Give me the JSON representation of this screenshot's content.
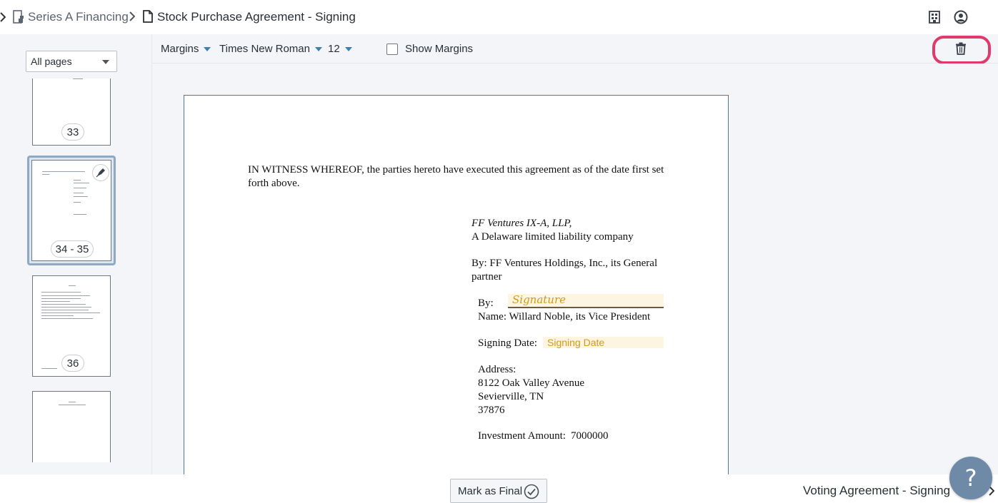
{
  "breadcrumb": {
    "series": "Series A Financing",
    "document": "Stock Purchase Agreement - Signing"
  },
  "sidebar": {
    "page_filter": "All pages",
    "thumbnails": [
      {
        "label": "33"
      },
      {
        "label": "34 - 35",
        "selected": true,
        "icon": "pen-nib-icon"
      },
      {
        "label": "36"
      },
      {
        "label": ""
      }
    ]
  },
  "toolbar": {
    "margins": "Margins",
    "font": "Times New Roman",
    "size": "12",
    "show_margins": "Show Margins",
    "show_margins_checked": false
  },
  "document": {
    "witness": "IN WITNESS WHEREOF, the parties hereto have executed this agreement as of the date first set",
    "witness_cont": "forth above.",
    "entity": "FF Ventures IX-A, LLP,",
    "entity_desc": "A Delaware limited liability company",
    "by_line": "By: FF Ventures Holdings, Inc., its General",
    "by_line_cont": "partner",
    "by_label": "By:",
    "signature_placeholder": "Signature",
    "name_line": "Name: Willard Noble, its Vice President",
    "signing_date_label": "Signing Date:",
    "signing_date_placeholder": "Signing Date",
    "address_label": "Address:",
    "address_line1": "8122 Oak Valley Avenue",
    "address_line2": "Sevierville, TN",
    "address_line3": "37876",
    "investment_label": "Investment Amount:",
    "investment_value": "7000000"
  },
  "footer": {
    "mark_final": "Mark as Final",
    "next_document": "Voting Agreement - Signing -",
    "help": "?"
  },
  "colors": {
    "accent": "#3f7fa9",
    "highlight_ring": "#e0396a",
    "field_fill": "#fdf5e2",
    "field_text": "#d29a18"
  }
}
